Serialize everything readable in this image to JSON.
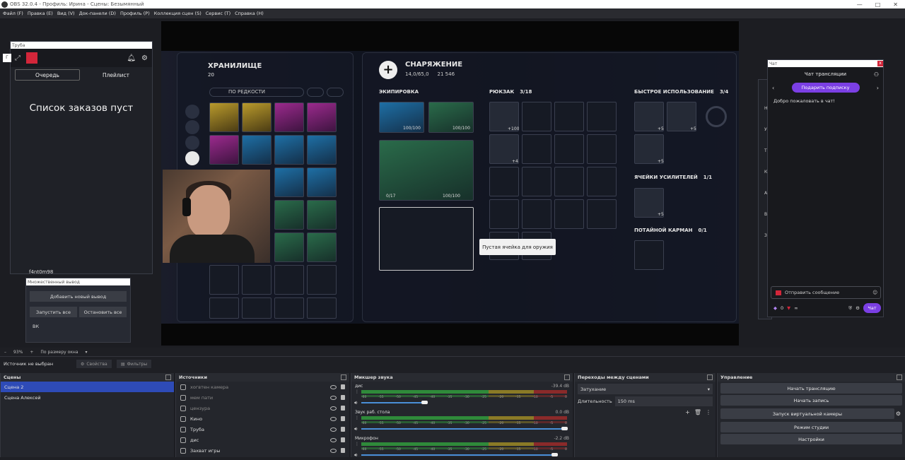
{
  "window": {
    "title": "OBS 32.0.4 - Профиль: Ирина - Сцены: Безымянный",
    "buttons": [
      "—",
      "□",
      "✕"
    ]
  },
  "menu": [
    "Файл (F)",
    "Правка (E)",
    "Вид (V)",
    "Док-панели (D)",
    "Профиль (P)",
    "Коллекция сцен (S)",
    "Сервис (T)",
    "Справка (H)"
  ],
  "queue_dock": {
    "title": "Труба",
    "tab_queue": "Очередь",
    "tab_playlist": "Плейлист",
    "empty": "Список заказов пуст",
    "user": "f4nt0m98",
    "sidebar_letter": "Г"
  },
  "multi_output": {
    "title": "Множественный вывод",
    "add_button": "Добавить новый вывод",
    "start_all": "Запустить все",
    "stop_all": "Остановить все",
    "item": "ВК"
  },
  "game": {
    "storage_title": "ХРАНИЛИЩЕ",
    "storage_count": "20",
    "sort_label": "ПО РЕДКОСТИ",
    "equipment_title": "СНАРЯЖЕНИЕ",
    "weight": "14,0/65,0",
    "money": "21 546",
    "section_equip": "ЭКИПИРОВКА",
    "equip_a": "100/100",
    "equip_b": "100/100",
    "weapon_ammo": "0/17",
    "weapon_dur": "100/100",
    "section_backpack": "РЮКЗАК",
    "backpack_count": "3/18",
    "bp_a": "+100",
    "bp_b": "+4",
    "section_quick": "БЫСТРОЕ ИСПОЛЬЗОВАНИЕ",
    "quick_count": "3/4",
    "qa": "+5",
    "qb": "+5",
    "qc": "+5",
    "section_boost": "ЯЧЕЙКИ УСИЛИТЕЛЕЙ",
    "boost_count": "1/1",
    "boost_a": "+5",
    "section_pocket": "ПОТАЙНОЙ КАРМАН",
    "pocket_count": "0/1",
    "tooltip": "Пустая ячейка для оружия"
  },
  "chat_dock": {
    "title": "Чат",
    "header": "Чат трансляции",
    "subscribe": "Подарить подписку",
    "welcome": "Добро пожаловать в чат!",
    "input_placeholder": "Отправить сообщение",
    "points": "0",
    "infinity": "∞",
    "send": "Чат",
    "side_letters": [
      "Н",
      "У",
      "Т",
      "К",
      "А",
      "В",
      "З"
    ]
  },
  "zoom": {
    "percent": "93%",
    "mode": "По размеру окна"
  },
  "source_bar": {
    "no_source": "Источник не выбран",
    "properties": "Свойства",
    "filters": "Фильтры"
  },
  "scenes": {
    "title": "Сцены",
    "items": [
      "Сцена 2",
      "Сцена Алексей"
    ]
  },
  "sources": {
    "title": "Источники",
    "items": [
      {
        "label": "хогвтен камера",
        "dim": true
      },
      {
        "label": "мем пати",
        "dim": true
      },
      {
        "label": "цензура",
        "dim": true
      },
      {
        "label": "Кино",
        "dim": false
      },
      {
        "label": "Труба",
        "dim": false
      },
      {
        "label": "дис",
        "dim": false
      },
      {
        "label": "Захват игры",
        "dim": false
      }
    ]
  },
  "mixer": {
    "title": "Микшер звука",
    "scale": [
      "-60",
      "-55",
      "-50",
      "-45",
      "-40",
      "-35",
      "-30",
      "-25",
      "-20",
      "-15",
      "-10",
      "-5",
      "0"
    ],
    "channels": [
      {
        "name": "дис",
        "db": "-39.4 dB",
        "level": 0.3
      },
      {
        "name": "Звук раб. стола",
        "db": "0.0 dB",
        "level": 1.0
      },
      {
        "name": "Микрофон",
        "db": "-2.2 dB",
        "level": 0.95
      }
    ]
  },
  "transitions": {
    "title": "Переходы между сценами",
    "type": "Затухание",
    "duration_label": "Длительность",
    "duration": "150 ms"
  },
  "controls": {
    "title": "Управление",
    "buttons": [
      "Начать трансляцию",
      "Начать запись",
      "Запуск виртуальной камеры",
      "Режим студии",
      "Настройки"
    ]
  },
  "colors": {
    "accent": "#2e4bb7",
    "twitch": "#7b3fe4",
    "meter_green": "#2f8a3a",
    "meter_yellow": "#8a7a26",
    "meter_red": "#8a2a2a"
  }
}
